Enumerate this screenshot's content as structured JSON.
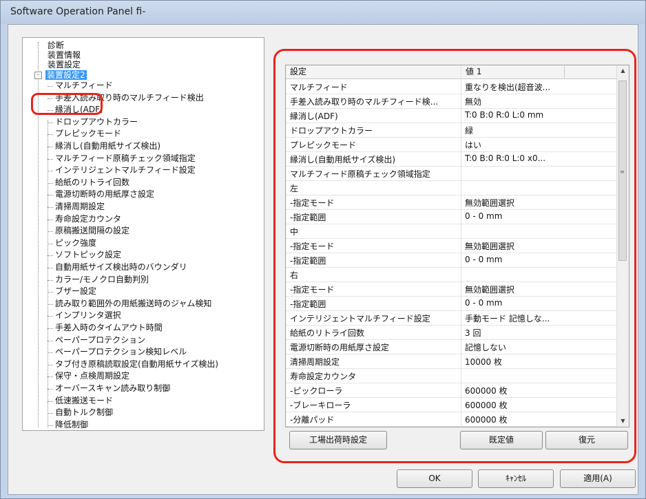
{
  "window": {
    "title": "Software Operation Panel fi-"
  },
  "tree": {
    "collapse_glyph": "-",
    "top_items": [
      "診断",
      "装置情報",
      "装置設定"
    ],
    "selected": "装置設定2",
    "children": [
      "マルチフィード",
      "手差入読み取り時のマルチフィード検出",
      "縁消し(ADF)",
      "ドロップアウトカラー",
      "プレピックモード",
      "縁消し(自動用紙サイズ検出)",
      "マルチフィード原稿チェック領域指定",
      "インテリジェントマルチフィード設定",
      "給紙のリトライ回数",
      "電源切断時の用紙厚さ設定",
      "清掃周期設定",
      "寿命設定カウンタ",
      "原稿搬送間隔の設定",
      "ピック強度",
      "ソフトピック設定",
      "自動用紙サイズ検出時のバウンダリ",
      "カラー/モノクロ自動判別",
      "ブザー設定",
      "読み取り範囲外の用紙搬送時のジャム検知",
      "インプリンタ選択",
      "手差入時のタイムアウト時間",
      "ペーパープロテクション",
      "ペーパープロテクション検知レベル",
      "タブ付き原稿読取設定(自動用紙サイズ検出)",
      "保守・点検周期設定",
      "オーバースキャン読み取り制御",
      "低速搬送モード",
      "自動トルク制御",
      "降低制御"
    ]
  },
  "grid": {
    "headers": [
      "設定",
      "値 1"
    ],
    "rows": [
      [
        "マルチフィード",
        "重なりを検出(超音波..."
      ],
      [
        "手差入読み取り時のマルチフィード検...",
        "無効"
      ],
      [
        "縁消し(ADF)",
        "T:0 B:0 R:0 L:0 mm"
      ],
      [
        "ドロップアウトカラー",
        "緑"
      ],
      [
        "プレピックモード",
        "はい"
      ],
      [
        "縁消し(自動用紙サイズ検出)",
        "T:0 B:0 R:0 L:0 x0..."
      ],
      [
        "マルチフィード原稿チェック領域指定",
        ""
      ],
      [
        "左",
        ""
      ],
      [
        "-指定モード",
        "無効範囲選択"
      ],
      [
        "-指定範囲",
        "0 - 0 mm"
      ],
      [
        "中",
        ""
      ],
      [
        "-指定モード",
        "無効範囲選択"
      ],
      [
        "-指定範囲",
        "0 - 0 mm"
      ],
      [
        "右",
        ""
      ],
      [
        "-指定モード",
        "無効範囲選択"
      ],
      [
        "-指定範囲",
        "0 - 0 mm"
      ],
      [
        "インテリジェントマルチフィード設定",
        "手動モード 記憶しな..."
      ],
      [
        "給紙のリトライ回数",
        "3 回"
      ],
      [
        "電源切断時の用紙厚さ設定",
        "記憶しない"
      ],
      [
        "清掃周期設定",
        "10000 枚"
      ],
      [
        "寿命設定カウンタ",
        ""
      ],
      [
        "-ピックローラ",
        "600000 枚"
      ],
      [
        "-ブレーキローラ",
        "600000 枚"
      ],
      [
        "-分離パッド",
        "600000 枚"
      ]
    ]
  },
  "scroll": {
    "up": "▲",
    "down": "▼",
    "grip": "≡"
  },
  "panel_buttons": {
    "factory": "工場出荷時設定",
    "default": "既定値",
    "restore": "復元"
  },
  "dialog_buttons": {
    "ok": "OK",
    "cancel": "ｷｬﾝｾﾙ",
    "apply": "適用(A)"
  },
  "colors": {
    "highlight": "#e8231b",
    "selection": "#3399ff"
  }
}
